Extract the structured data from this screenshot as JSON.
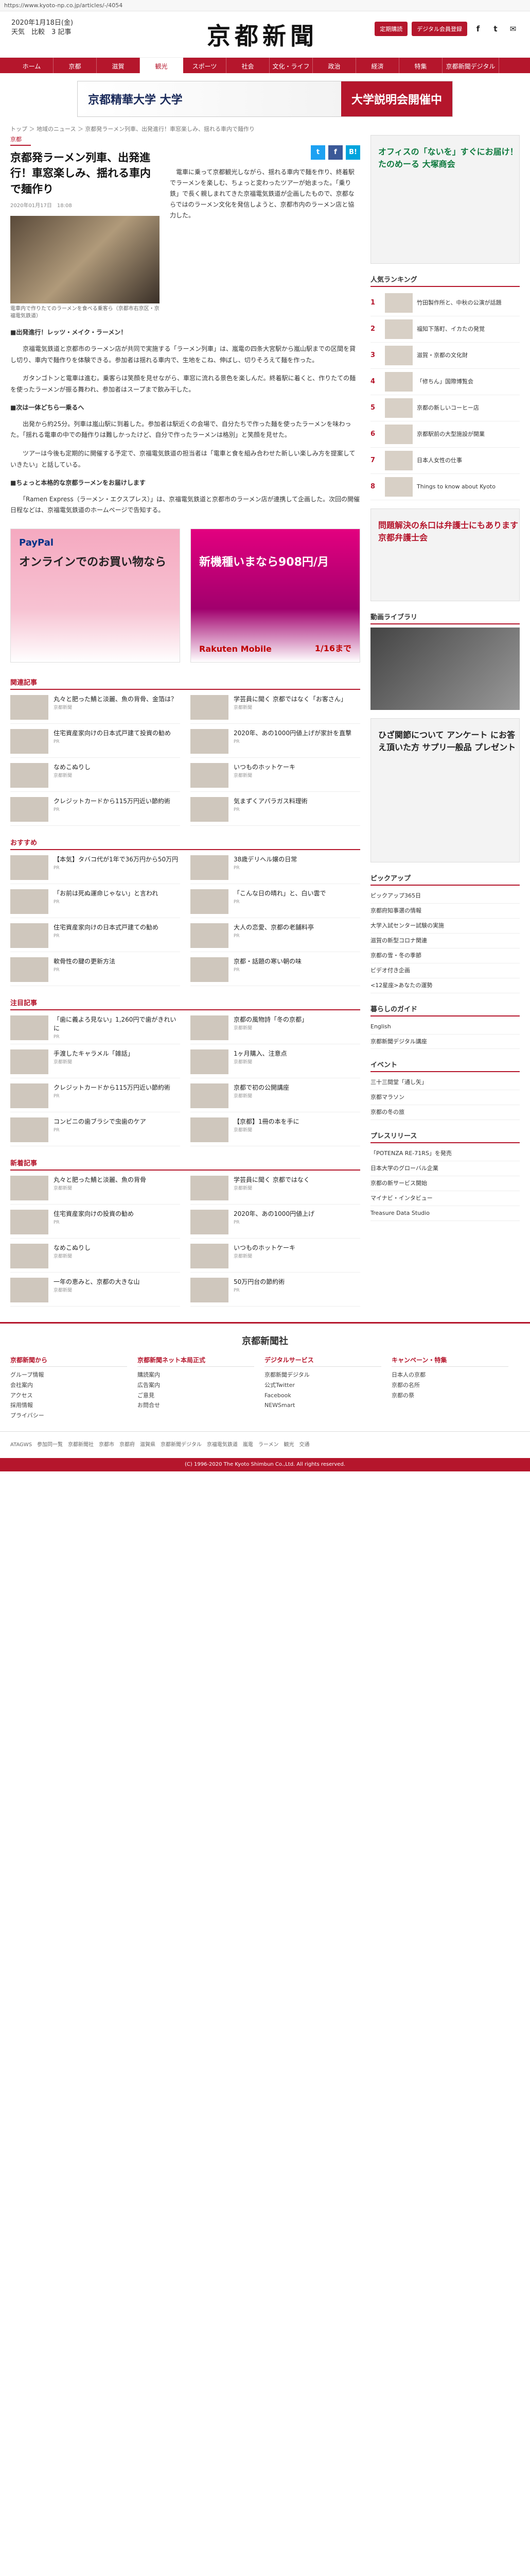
{
  "url": "https://www.kyoto-np.co.jp/articles/-/4054",
  "header": {
    "date_line": "2020年1月18日(金)",
    "weather_line": "天気　比較　3 記事",
    "logo": "京都新聞",
    "btn_subscribe": "定期購読",
    "btn_digital": "デジタル会員登録",
    "social_f": "f",
    "social_t": "t",
    "social_mail": "✉"
  },
  "nav": [
    {
      "label": "ホーム"
    },
    {
      "label": "京都"
    },
    {
      "label": "滋賀"
    },
    {
      "label": "観光"
    },
    {
      "label": "スポーツ"
    },
    {
      "label": "社会"
    },
    {
      "label": "文化・ライフ"
    },
    {
      "label": "政治"
    },
    {
      "label": "経済"
    },
    {
      "label": "特集"
    },
    {
      "label": "京都新聞デジタル"
    }
  ],
  "banner": {
    "left": "京都精華大学 大学",
    "right": "大学説明会開催中"
  },
  "breadcrumb": "トップ ＞ 地域のニュース ＞ 京都発ラーメン列車、出発進行！車窓楽しみ、揺れる車内で麺作り",
  "article": {
    "section": "京都",
    "title": "京都発ラーメン列車、出発進行！車窓楽しみ、揺れる車内で麺作り",
    "pubdate": "2020年01月17日　18:08",
    "photo_caption": "電車内で作りたてのラーメンを食べる乗客ら（京都市右京区・京福電気鉄道）",
    "lead": "　電車に乗って京都観光しながら、揺れる車内で麺を作り、終着駅でラーメンを楽しむ、ちょっと変わったツアーが始まった。「乗り鉄」で長く親しまれてきた京福電気鉄道が企画したもので、京都ならではのラーメン文化を発信しようと、京都市内のラーメン店と協力した。",
    "h1": "■出発進行！レッツ・メイク・ラーメン！",
    "p1": "　京福電気鉄道と京都市のラーメン店が共同で実施する「ラーメン列車」は、嵐電の四条大宮駅から嵐山駅までの区間を貸し切り、車内で麺作りを体験できる。参加者は揺れる車内で、生地をこね、伸ばし、切りそろえて麺を作った。",
    "p2": "　ガタンゴトンと電車は進む。乗客らは笑顔を見せながら、車窓に流れる景色を楽しんだ。終着駅に着くと、作りたての麺を使ったラーメンが振る舞われ、参加者はスープまで飲み干した。",
    "h2": "■次は一体どちら一乗るへ",
    "p3": "　出発から約25分。列車は嵐山駅に到着した。参加者は駅近くの会場で、自分たちで作った麺を使ったラーメンを味わった。「揺れる電車の中での麺作りは難しかったけど、自分で作ったラーメンは格別」と笑顔を見せた。",
    "p4": "　ツアーは今後も定期的に開催する予定で、京福電気鉄道の担当者は「電車と食を組み合わせた新しい楽しみ方を提案していきたい」と話している。",
    "h3": "■ちょっと本格的な京都ラーメンをお届けします",
    "p5": "　「Ramen Express（ラーメン・エクスプレス）」は、京福電気鉄道と京都市のラーメン店が連携して企画した。次回の開催日程などは、京福電気鉄道のホームページで告知する。"
  },
  "share": {
    "tw": "t",
    "fb": "f",
    "hb": "B!"
  },
  "ads": {
    "paypal_brand": "PayPal",
    "paypal_text": "オンラインでのお買い物なら",
    "rakuten_brand": "Rakuten Mobile",
    "rakuten_text": "新機種いまなら908円/月",
    "rakuten_date": "1/16まで"
  },
  "related": {
    "heading": "関連記事",
    "items": [
      {
        "title": "丸々と肥った鯖と淡麗、魚の背骨、金箔は？",
        "src": "京都新聞"
      },
      {
        "title": "学芸員に聞く 京都ではなく「お客さん」",
        "src": "京都新聞"
      },
      {
        "title": "住宅資産家向けの日本式戸建て投資の勧め",
        "src": "PR"
      },
      {
        "title": "2020年、あの1000円値上げが家計を直撃",
        "src": "PR"
      },
      {
        "title": "なめこぬりし",
        "src": "京都新聞"
      },
      {
        "title": "いつものホットケーキ",
        "src": "京都新聞"
      },
      {
        "title": "クレジットカードから115万円近い節約術",
        "src": "PR"
      },
      {
        "title": "気まずくアパラガス料理術",
        "src": "PR"
      }
    ]
  },
  "recommend": {
    "heading": "おすすめ",
    "items": [
      {
        "title": "【本気】タバコ代が1年で36万円から50万円",
        "src": "PR"
      },
      {
        "title": "38歳デリヘル嬢の日常",
        "src": "PR"
      },
      {
        "title": "「お前は死ぬ運命じゃない」と言われ",
        "src": "PR"
      },
      {
        "title": "「こんな日の晴れ」と、白い雲で",
        "src": "PR"
      },
      {
        "title": "住宅資産家向けの日本式戸建ての勧め",
        "src": "PR"
      },
      {
        "title": "大人の恋愛、京都の老舗料亭",
        "src": "PR"
      },
      {
        "title": "軟骨性の腱の更新方法",
        "src": "PR"
      },
      {
        "title": "京都・話題の寒い朝の味",
        "src": "PR"
      }
    ]
  },
  "popular": {
    "heading": "注目記事",
    "items": [
      {
        "title": "「歯に義よろ見ない」1,260円で歯がきれいに",
        "src": "PR"
      },
      {
        "title": "京都の風物詩「冬の京都」",
        "src": "京都新聞"
      },
      {
        "title": "手渡したキャラメル「雑話」",
        "src": "京都新聞"
      },
      {
        "title": "1ヶ月購入、注意点",
        "src": "京都新聞"
      },
      {
        "title": "クレジットカードから115万円近い節約術",
        "src": "PR"
      },
      {
        "title": "京都で初の公開講座",
        "src": "京都新聞"
      },
      {
        "title": "コンビニの歯ブラシで虫歯のケア",
        "src": "PR"
      },
      {
        "title": "【京都】1冊の本を手に",
        "src": "京都新聞"
      }
    ]
  },
  "newest": {
    "heading": "新着記事",
    "items": [
      {
        "title": "丸々と肥った鯖と淡麗、魚の背骨",
        "src": "京都新聞"
      },
      {
        "title": "学芸員に聞く 京都ではなく",
        "src": "京都新聞"
      },
      {
        "title": "住宅資産家向けの投資の勧め",
        "src": "PR"
      },
      {
        "title": "2020年、あの1000円値上げ",
        "src": "PR"
      },
      {
        "title": "なめこぬりし",
        "src": "京都新聞"
      },
      {
        "title": "いつものホットケーキ",
        "src": "京都新聞"
      },
      {
        "title": "一年の恵みと、京都の大きな山",
        "src": "京都新聞"
      },
      {
        "title": "50万円台の節約術",
        "src": "PR"
      }
    ]
  },
  "side": {
    "ad1": "オフィスの「ないを」すぐにお届け！たのめーる 大塚商会",
    "rank_heading": "人気ランキング",
    "ranks": [
      {
        "n": "1",
        "t": "竹田製作所と、中秋の公演が話題"
      },
      {
        "n": "2",
        "t": "福知下落町、イカたの発覚"
      },
      {
        "n": "3",
        "t": "滋賀・京都の文化財"
      },
      {
        "n": "4",
        "t": "「修ちん」国際博覧会"
      },
      {
        "n": "5",
        "t": "京都の新しいコーヒー店"
      },
      {
        "n": "6",
        "t": "京都駅前の大型施設が開業"
      },
      {
        "n": "7",
        "t": "日本人女性の仕事"
      },
      {
        "n": "8",
        "t": "Things to know about Kyoto"
      }
    ],
    "ad2": "問題解決の糸口は弁護士にもあります 京都弁護士会",
    "live_heading": "動画ライブラリ",
    "ad3": "ひざ関節について アンケート にお答え頂いた方 サプリ一般品 プレゼント",
    "pick_heading": "ピックアップ",
    "picks": [
      "ピックアップ365日",
      "京都府知事選の情報",
      "大学入試センター試験の実施",
      "滋賀の新型コロナ関連",
      "京都の雪・冬の季節",
      "ビデオ付き企画",
      "<12星座>あなたの運勢"
    ],
    "life_heading": "暮らしのガイド",
    "life": [
      "English",
      "京都新聞デジタル講座"
    ],
    "event_heading": "イベント",
    "events": [
      "三十三間堂「通し矢」",
      "京都マラソン",
      "京都の冬の旅"
    ],
    "press_heading": "プレスリリース",
    "press": [
      "「POTENZA RE-71RS」を発売",
      "日本大学のグローバル企業",
      "京都の新サービス開始",
      "マイナビ・インタビュー",
      "Treasure Data Studio"
    ]
  },
  "footer": {
    "logo": "京都新聞社",
    "cols": [
      {
        "h": "京都新聞から",
        "items": [
          "グループ情報",
          "会社案内",
          "アクセス",
          "採用情報",
          "プライバシー"
        ]
      },
      {
        "h": "京都新聞ネット本局正式",
        "items": [
          "購読案内",
          "広告案内",
          "ご意見",
          "お問合せ"
        ]
      },
      {
        "h": "デジタルサービス",
        "items": [
          "京都新聞デジタル",
          "公式Twitter",
          "Facebook",
          "NEWSmart"
        ]
      },
      {
        "h": "キャンペーン・特集",
        "items": [
          "日本人の京都",
          "京都の名所",
          "京都の祭"
        ]
      }
    ]
  },
  "tags": "ATAGWS　参加同一覧　京都新聞社　京都市　京都府　滋賀県　京都新聞デジタル　京福電気鉄道　嵐電　ラーメン　観光　交通",
  "copyright": "(C) 1996-2020 The Kyoto Shimbun Co.,Ltd. All rights reserved."
}
